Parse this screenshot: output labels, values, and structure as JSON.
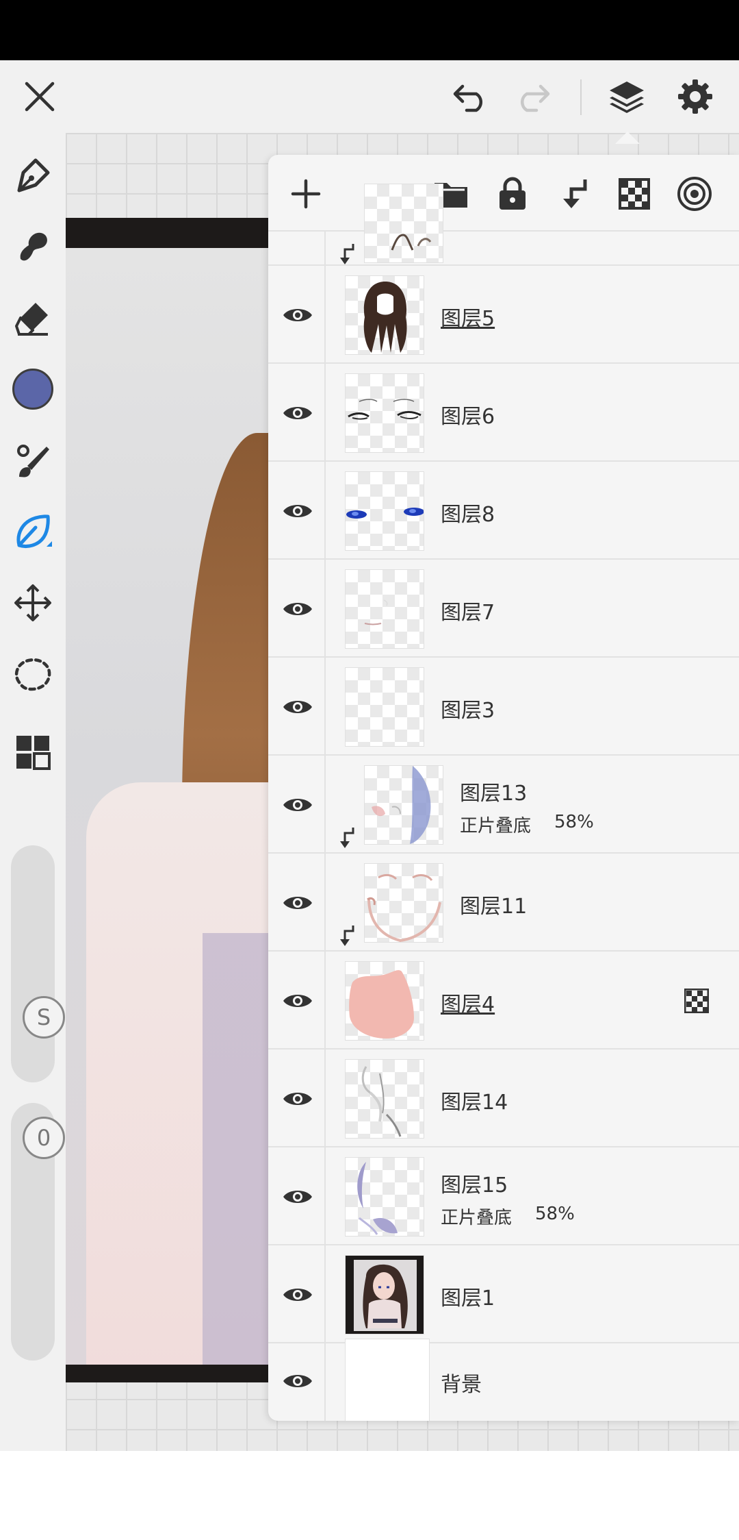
{
  "app": {
    "colors": {
      "accent": "#1e88e5",
      "current_color": "#5b66a8",
      "toolbar_bg": "#f1f1f1",
      "panel_bg": "#f5f5f5"
    }
  },
  "topbar": {
    "icons": [
      "close-icon",
      "undo-icon",
      "redo-icon",
      "layers-icon",
      "gear-icon"
    ]
  },
  "left_toolbar": {
    "tools": [
      "pen-icon",
      "smudge-icon",
      "eraser-icon",
      "color-swatch",
      "brush-icon",
      "lasso-fill-icon",
      "move-icon",
      "selection-icon",
      "grid-icon"
    ],
    "brush_size_slider": {
      "label": "S",
      "level": 0.75
    },
    "opacity_slider": {
      "label": "0",
      "level": 0.05
    }
  },
  "layer_panel": {
    "toolbar_icons": [
      "add-icon",
      "folder-icon",
      "lock-icon",
      "clip-icon",
      "checker-icon",
      "reference-icon"
    ],
    "layers": [
      {
        "name": "图层5",
        "underlined": true,
        "mode": "",
        "opacity": "",
        "clipped": false,
        "thumb": "hair"
      },
      {
        "name": "图层6",
        "underlined": false,
        "mode": "",
        "opacity": "",
        "clipped": false,
        "thumb": "eyes-lines"
      },
      {
        "name": "图层8",
        "underlined": false,
        "mode": "",
        "opacity": "",
        "clipped": false,
        "thumb": "eyes-blue"
      },
      {
        "name": "图层7",
        "underlined": false,
        "mode": "",
        "opacity": "",
        "clipped": false,
        "thumb": "mouth"
      },
      {
        "name": "图层3",
        "underlined": false,
        "mode": "",
        "opacity": "",
        "clipped": false,
        "thumb": "empty"
      },
      {
        "name": "图层13",
        "underlined": false,
        "mode": "正片叠底",
        "opacity": "58%",
        "clipped": true,
        "thumb": "shade-blue"
      },
      {
        "name": "图层11",
        "underlined": false,
        "mode": "",
        "opacity": "",
        "clipped": true,
        "thumb": "blush"
      },
      {
        "name": "图层4",
        "underlined": true,
        "mode": "",
        "opacity": "",
        "clipped": false,
        "thumb": "skin",
        "alpha_locked": true
      },
      {
        "name": "图层14",
        "underlined": false,
        "mode": "",
        "opacity": "",
        "clipped": false,
        "thumb": "white-lines"
      },
      {
        "name": "图层15",
        "underlined": false,
        "mode": "正片叠底",
        "opacity": "58%",
        "clipped": false,
        "thumb": "shade-purple"
      },
      {
        "name": "图层1",
        "underlined": false,
        "mode": "",
        "opacity": "",
        "clipped": false,
        "thumb": "full-art"
      },
      {
        "name": "背景",
        "underlined": false,
        "mode": "",
        "opacity": "",
        "clipped": false,
        "thumb": "white"
      }
    ]
  }
}
